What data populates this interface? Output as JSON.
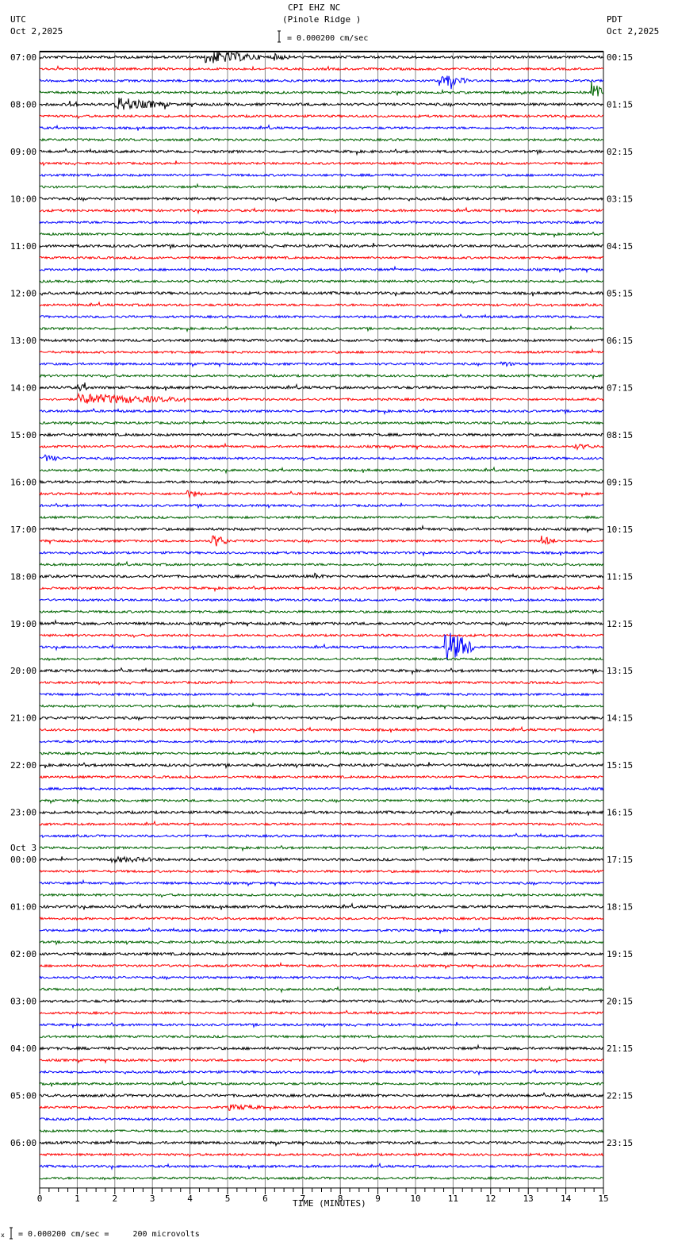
{
  "header": {
    "station": "CPI EHZ NC",
    "location": "(Pinole Ridge )",
    "left_tz": "UTC",
    "left_date": "Oct 2,2025",
    "right_tz": "PDT",
    "right_date": "Oct 2,2025",
    "scale_text": "= 0.000200 cm/sec"
  },
  "footer": {
    "scale_text": "= 0.000200 cm/sec =     200 microvolts",
    "scale_prefix": "x"
  },
  "chart_data": {
    "type": "line",
    "title": "CPI EHZ NC (Pinole Ridge )",
    "xlabel": "TIME (MINUTES)",
    "xlim": [
      0,
      15
    ],
    "x_ticks": [
      "0",
      "1",
      "2",
      "3",
      "4",
      "5",
      "6",
      "7",
      "8",
      "9",
      "10",
      "11",
      "12",
      "13",
      "14",
      "15"
    ],
    "trace_count": 96,
    "trace_minutes": 15,
    "trace_colors": [
      "#000000",
      "#ff0000",
      "#0000ff",
      "#006400"
    ],
    "date_change_label": "Oct 3",
    "date_change_before_label_index": 17,
    "left_labels": [
      "07:00",
      "08:00",
      "09:00",
      "10:00",
      "11:00",
      "12:00",
      "13:00",
      "14:00",
      "15:00",
      "16:00",
      "17:00",
      "18:00",
      "19:00",
      "20:00",
      "21:00",
      "22:00",
      "23:00",
      "00:00",
      "01:00",
      "02:00",
      "03:00",
      "04:00",
      "05:00",
      "06:00"
    ],
    "right_labels": [
      "00:15",
      "01:15",
      "02:15",
      "03:15",
      "04:15",
      "05:15",
      "06:15",
      "07:15",
      "08:15",
      "09:15",
      "10:15",
      "11:15",
      "12:15",
      "13:15",
      "14:15",
      "15:15",
      "16:15",
      "17:15",
      "18:15",
      "19:15",
      "20:15",
      "21:15",
      "22:15",
      "23:15"
    ],
    "events": [
      {
        "trace": 0,
        "minute": 4.4,
        "duration": 1.5,
        "amplitude": 9
      },
      {
        "trace": 0,
        "minute": 6.2,
        "duration": 0.6,
        "amplitude": 5
      },
      {
        "trace": 2,
        "minute": 10.6,
        "duration": 0.8,
        "amplitude": 8
      },
      {
        "trace": 3,
        "minute": 14.65,
        "duration": 0.3,
        "amplitude": 18
      },
      {
        "trace": 4,
        "minute": 0.8,
        "duration": 0.3,
        "amplitude": 5
      },
      {
        "trace": 4,
        "minute": 2.0,
        "duration": 1.0,
        "amplitude": 10
      },
      {
        "trace": 4,
        "minute": 2.9,
        "duration": 0.7,
        "amplitude": 5
      },
      {
        "trace": 26,
        "minute": 12.2,
        "duration": 0.6,
        "amplitude": 4
      },
      {
        "trace": 28,
        "minute": 1.0,
        "duration": 0.4,
        "amplitude": 5
      },
      {
        "trace": 29,
        "minute": 1.0,
        "duration": 3.0,
        "amplitude": 7
      },
      {
        "trace": 33,
        "minute": 14.2,
        "duration": 0.8,
        "amplitude": 4
      },
      {
        "trace": 34,
        "minute": 0.1,
        "duration": 0.5,
        "amplitude": 5
      },
      {
        "trace": 37,
        "minute": 3.9,
        "duration": 0.5,
        "amplitude": 5
      },
      {
        "trace": 41,
        "minute": 4.55,
        "duration": 0.5,
        "amplitude": 9
      },
      {
        "trace": 41,
        "minute": 13.35,
        "duration": 0.4,
        "amplitude": 7
      },
      {
        "trace": 44,
        "minute": 7.3,
        "duration": 0.3,
        "amplitude": 5
      },
      {
        "trace": 50,
        "minute": 10.75,
        "duration": 0.8,
        "amplitude": 22
      },
      {
        "trace": 68,
        "minute": 1.9,
        "duration": 1.7,
        "amplitude": 4
      },
      {
        "trace": 89,
        "minute": 5.0,
        "duration": 1.2,
        "amplitude": 4
      }
    ]
  }
}
